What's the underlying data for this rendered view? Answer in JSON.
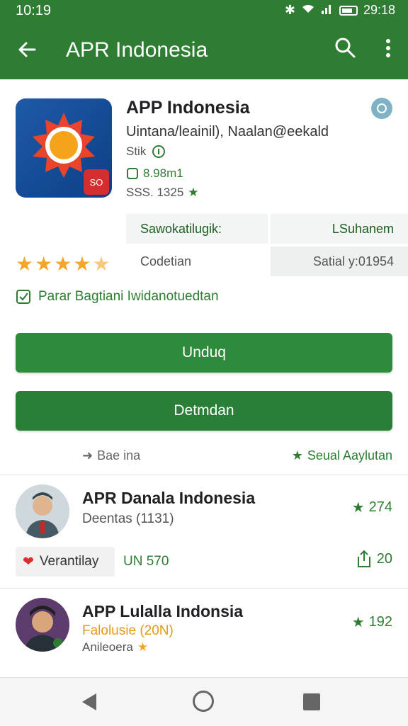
{
  "status": {
    "time": "10:19",
    "clock_right": "29:18"
  },
  "toolbar": {
    "title": "APR Indonesia"
  },
  "app": {
    "name": "APP Indonesia",
    "subtitle": "Uintana/leainil), Naalan@eekald",
    "meta1": "Stik",
    "meta2": "8.98m1",
    "meta3": "SSS. 1325",
    "icon_badge": "SO"
  },
  "info": {
    "c1": "Sawokatilugik:",
    "c2": "LSuhanem",
    "c3": "Codetian",
    "c4": "Satial y:01954"
  },
  "rating": {
    "stars": 4.5
  },
  "verified": "Parar Bagtiani Iwidanotuedtan",
  "buttons": {
    "primary": "Unduq",
    "secondary": "Detmdan"
  },
  "under": {
    "left": "Bae ina",
    "right": "Seual Aaylutan"
  },
  "reviews": [
    {
      "name": "APR Danala Indonesia",
      "sub": "Deentas (1131)",
      "score": "274",
      "tag": "Verantilay",
      "un": "UN 570",
      "shares": "20"
    },
    {
      "name": "APP Lulalla Indonsia",
      "sub": "Falolusie (20N)",
      "score": "192",
      "extra": "Anileoera"
    }
  ],
  "colors": {
    "brand_green": "#2e7d32",
    "star": "#f4a62a"
  }
}
